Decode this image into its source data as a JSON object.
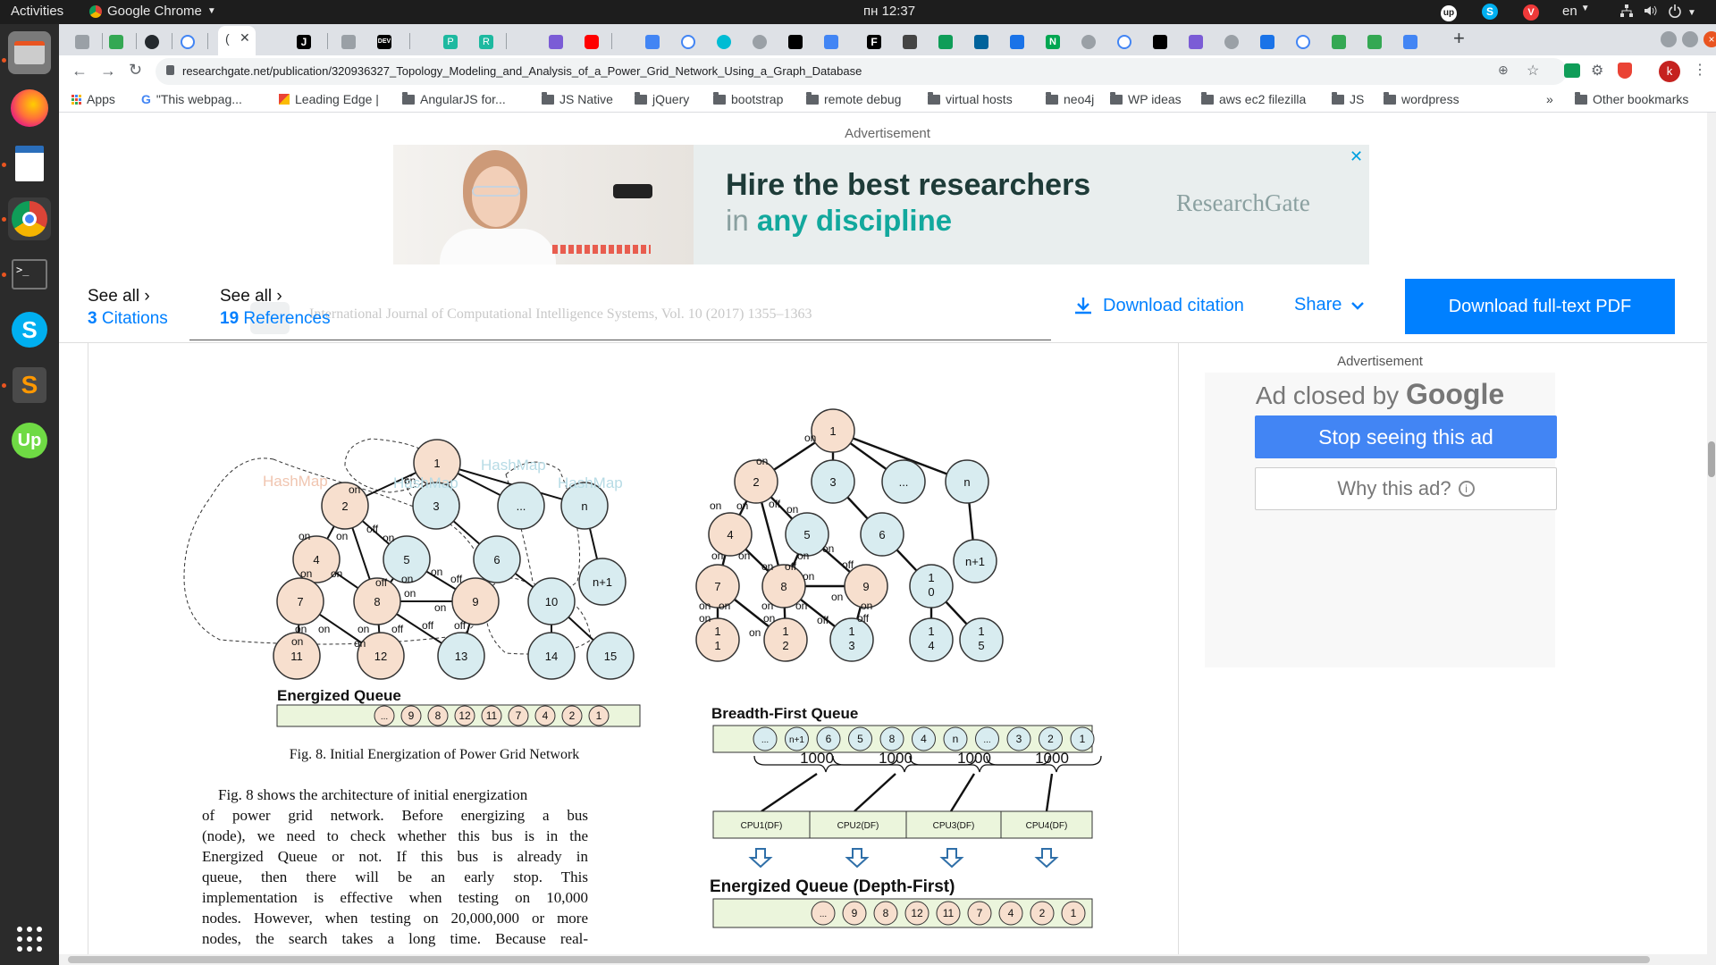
{
  "topbar": {
    "activities": "Activities",
    "app_name": "Google Chrome",
    "clock": "пн 12:37",
    "language": "en"
  },
  "browser": {
    "url": "researchgate.net/publication/320936327_Topology_Modeling_and_Analysis_of_a_Power_Grid_Network_Using_a_Graph_Database",
    "active_tab_label": "(",
    "bookmarks": [
      {
        "label": "Apps"
      },
      {
        "label": "\"This webpag..."
      },
      {
        "label": "Leading Edge |"
      },
      {
        "label": "AngularJS for..."
      },
      {
        "label": "JS Native"
      },
      {
        "label": "jQuery"
      },
      {
        "label": "bootstrap"
      },
      {
        "label": "remote debug"
      },
      {
        "label": "virtual hosts"
      },
      {
        "label": "neo4j"
      },
      {
        "label": "WP ideas"
      },
      {
        "label": "aws ec2 filezilla"
      },
      {
        "label": "JS"
      },
      {
        "label": "wordpress"
      }
    ],
    "more_bookmarks": "»",
    "other_bookmarks": "Other bookmarks",
    "profile_initial": "k"
  },
  "ad_banner": {
    "label": "Advertisement",
    "headline": "Hire the best researchers",
    "subline_prefix": "in ",
    "subline_accent": "any discipline",
    "brand": "ResearchGate"
  },
  "article_header": {
    "citations_see_all": "See all ›",
    "citations_count": "3",
    "citations_label": "Citations",
    "references_see_all": "See all ›",
    "references_count": "19",
    "references_label": "References",
    "journal_ghost": "International Journal of Computational Intelligence Systems, Vol. 10 (2017) 1355–1363",
    "download_citation": "Download citation",
    "share": "Share",
    "download_pdf": "Download full-text PDF"
  },
  "side_ad": {
    "label": "Advertisement",
    "closed_by": "Ad closed by",
    "google": "Google",
    "stop_seeing": "Stop seeing this ad",
    "why_this_ad": "Why this ad?"
  },
  "figure_left": {
    "hashmap_labels": [
      "HashMap",
      "HashMap",
      "HashMap",
      "HashMap"
    ],
    "queue_title": "Energized Queue",
    "queue_items": [
      "...",
      "9",
      "8",
      "12",
      "11",
      "7",
      "4",
      "2",
      "1"
    ],
    "caption": "Fig. 8.  Initial Energization of Power Grid Network"
  },
  "figure_right": {
    "bfq_title": "Breadth-First  Queue",
    "bfq_items": [
      "...",
      "n+1",
      "6",
      "5",
      "8",
      "4",
      "n",
      "...",
      "3",
      "2",
      "1"
    ],
    "batch_labels": [
      "1000",
      "1000",
      "1000",
      "1000"
    ],
    "cpu_labels": [
      "CPU1(DF)",
      "CPU2(DF)",
      "CPU3(DF)",
      "CPU4(DF)"
    ],
    "eq_title": "Energized Queue (Depth-First)",
    "eq_items": [
      "...",
      "9",
      "8",
      "12",
      "11",
      "7",
      "4",
      "2",
      "1"
    ]
  },
  "paper_paragraph": [
    "Fig. 8 shows the architecture of initial energization",
    "of power grid network. Before energizing a bus",
    "(node), we need to check whether this bus is in the",
    "Energized Queue or not. If this bus is already in",
    "queue, then there will be an early stop. This",
    "implementation is effective when testing on 10,000",
    "nodes. However, when testing on 20,000,000 or more",
    "nodes, the search takes a long time. Because real-"
  ]
}
